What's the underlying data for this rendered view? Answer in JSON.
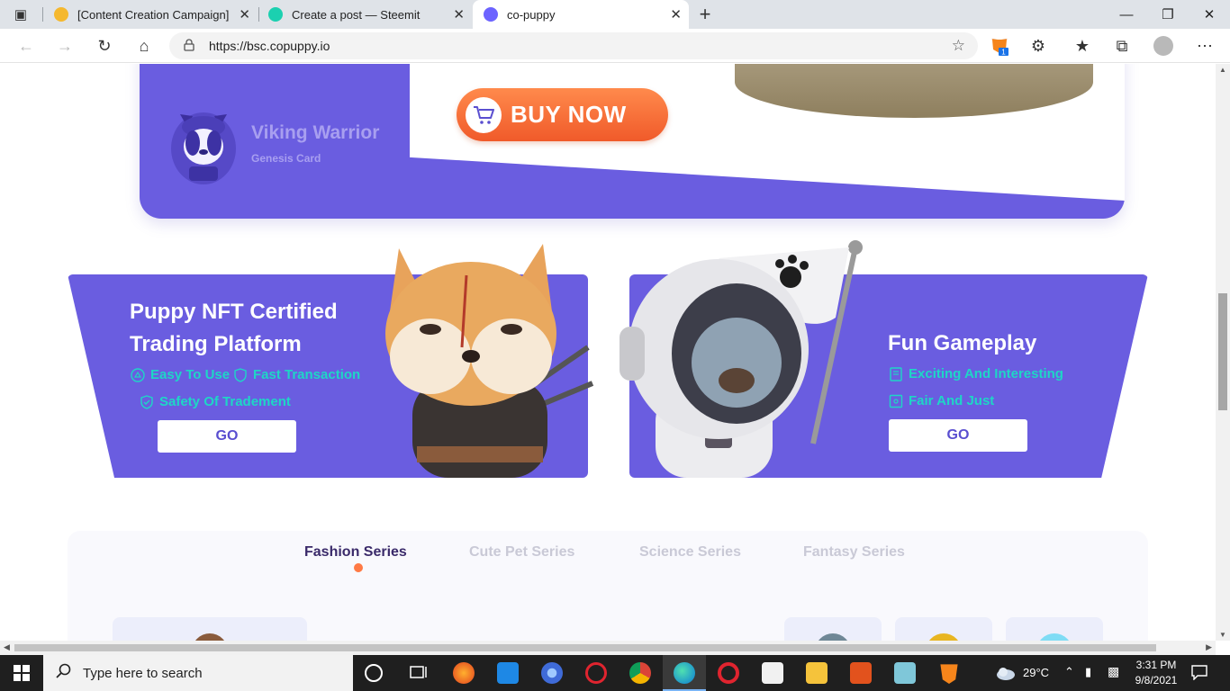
{
  "browser": {
    "tabs": [
      {
        "title": "[Content Creation Campaign] Co",
        "favicon_color": "#f5b82e",
        "active": false
      },
      {
        "title": "Create a post — Steemit",
        "favicon_color": "#1bd0b0",
        "active": false
      },
      {
        "title": "co-puppy",
        "favicon_color": "#6c63ff",
        "active": true
      }
    ],
    "url": "https://bsc.copuppy.io",
    "extension_badge": "1"
  },
  "banner": {
    "card_name": "Viking Warrior",
    "card_type": "Genesis Card",
    "buy_label": "BUY NOW"
  },
  "cards": {
    "left": {
      "title_line1": "Puppy NFT Certified",
      "title_line2": "Trading Platform",
      "features": [
        "Easy To Use",
        "Fast Transaction",
        "Safety Of Tradement"
      ],
      "go_label": "GO"
    },
    "right": {
      "title": "Fun Gameplay",
      "features": [
        "Exciting And Interesting",
        "Fair And Just"
      ],
      "go_label": "GO"
    }
  },
  "series": {
    "tabs": [
      "Fashion Series",
      "Cute Pet Series",
      "Science Series",
      "Fantasy Series"
    ],
    "active_index": 0
  },
  "taskbar": {
    "search_placeholder": "Type here to search",
    "temperature": "29°C",
    "time": "3:31 PM",
    "date": "9/8/2021"
  },
  "colors": {
    "brand_purple": "#6a5de0",
    "buy_orange": "#f26a35",
    "feature_teal": "#1ed6c6",
    "active_dot": "#ff7a45"
  }
}
